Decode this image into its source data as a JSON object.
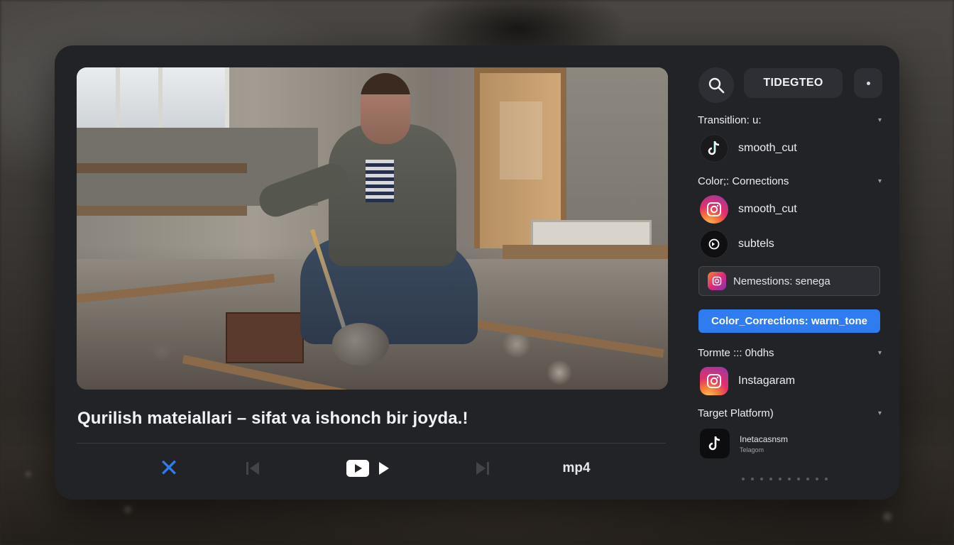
{
  "header": {
    "title": "TIDEGTEO"
  },
  "video": {
    "caption": "Qurilish mateiallari – sifat va ishonch bir joyda.!"
  },
  "controls": {
    "format": "mp4"
  },
  "sidebar": {
    "sections": [
      {
        "heading": "Transitlion: u:",
        "option": "smooth_cut",
        "icon": "tiktok-icon"
      },
      {
        "heading": "Color;: Cornections",
        "options": [
          {
            "label": "smooth_cut",
            "icon": "instagram-icon"
          },
          {
            "label": "subtels",
            "icon": "circle-arrow-icon"
          }
        ]
      }
    ],
    "field_value": "Nemestions: senega",
    "primary_button": "Color_Corrections: warm_tone",
    "format_section": {
      "heading": "Tormte ::: 0hdhs",
      "option": "Instagaram"
    },
    "target_section": {
      "heading": "Target Platform)",
      "line1": "Inetacasnsm",
      "line2": "Telagom"
    }
  },
  "colors": {
    "accent": "#2f7cf0",
    "panel": "#222327"
  }
}
